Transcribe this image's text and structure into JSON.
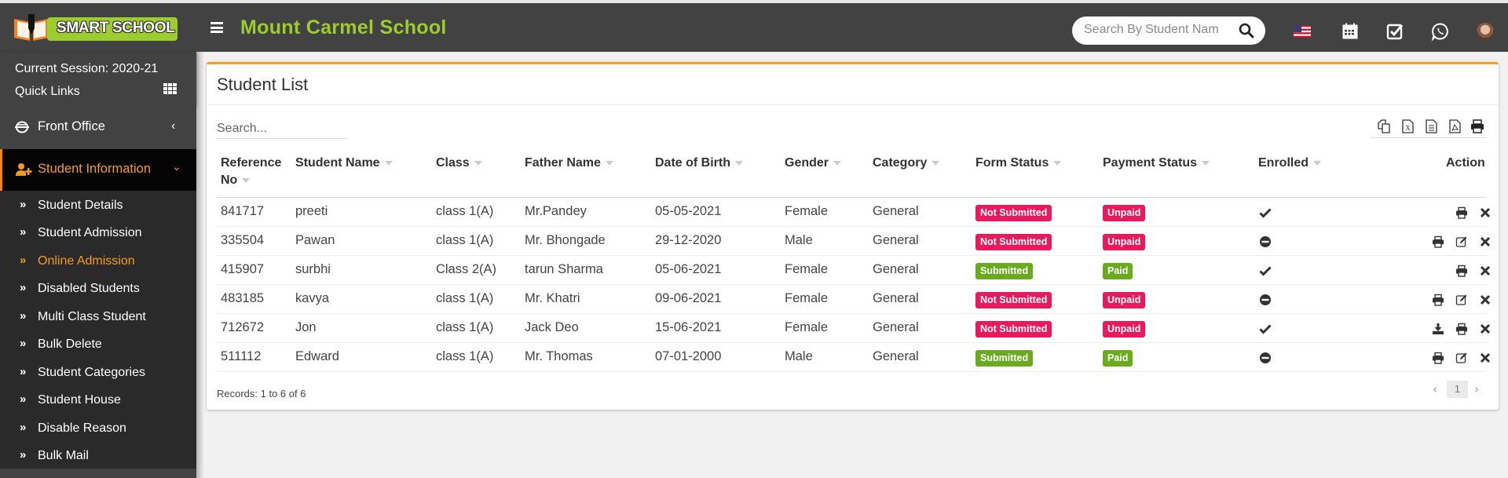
{
  "header": {
    "logo_text": "SMART SCHOOL",
    "school_name": "Mount Carmel School",
    "search_placeholder": "Search By Student Name",
    "icons": [
      "us-flag-icon",
      "calendar-icon",
      "task-check-icon",
      "whatsapp-icon",
      "user-avatar"
    ]
  },
  "sidebar": {
    "session": "Current Session: 2020-21",
    "quick_links": "Quick Links",
    "front_office": "Front Office",
    "student_information": "Student Information",
    "sub_items": [
      {
        "label": "Student Details",
        "active": false
      },
      {
        "label": "Student Admission",
        "active": false
      },
      {
        "label": "Online Admission",
        "active": true
      },
      {
        "label": "Disabled Students",
        "active": false
      },
      {
        "label": "Multi Class Student",
        "active": false
      },
      {
        "label": "Bulk Delete",
        "active": false
      },
      {
        "label": "Student Categories",
        "active": false
      },
      {
        "label": "Student House",
        "active": false
      },
      {
        "label": "Disable Reason",
        "active": false
      },
      {
        "label": "Bulk Mail",
        "active": false
      }
    ]
  },
  "main": {
    "title": "Student List",
    "search_placeholder": "Search...",
    "export_buttons": [
      "copy",
      "excel",
      "csv",
      "pdf",
      "print"
    ],
    "columns": {
      "ref_line1": "Reference",
      "ref_line2": "No",
      "student_name": "Student Name",
      "class": "Class",
      "father_name": "Father Name",
      "dob": "Date of Birth",
      "gender": "Gender",
      "category": "Category",
      "form_status": "Form Status",
      "payment_status": "Payment Status",
      "enrolled": "Enrolled",
      "action": "Action"
    },
    "rows": [
      {
        "ref": "841717",
        "name": "preeti",
        "class": "class 1(A)",
        "father": "Mr.Pandey",
        "dob": "05-05-2021",
        "gender": "Female",
        "category": "General",
        "form_status": "Not Submitted",
        "payment_status": "Unpaid",
        "enrolled": "yes",
        "actions": [
          "print",
          "delete"
        ]
      },
      {
        "ref": "335504",
        "name": "Pawan",
        "class": "class 1(A)",
        "father": "Mr. Bhongade",
        "dob": "29-12-2020",
        "gender": "Male",
        "category": "General",
        "form_status": "Not Submitted",
        "payment_status": "Unpaid",
        "enrolled": "no",
        "actions": [
          "print",
          "edit",
          "delete"
        ]
      },
      {
        "ref": "415907",
        "name": "surbhi",
        "class": "Class 2(A)",
        "father": "tarun Sharma",
        "dob": "05-06-2021",
        "gender": "Female",
        "category": "General",
        "form_status": "Submitted",
        "payment_status": "Paid",
        "enrolled": "yes",
        "actions": [
          "print",
          "delete"
        ]
      },
      {
        "ref": "483185",
        "name": "kavya",
        "class": "class 1(A)",
        "father": "Mr. Khatri",
        "dob": "09-06-2021",
        "gender": "Female",
        "category": "General",
        "form_status": "Not Submitted",
        "payment_status": "Unpaid",
        "enrolled": "no",
        "actions": [
          "print",
          "edit",
          "delete"
        ]
      },
      {
        "ref": "712672",
        "name": "Jon",
        "class": "class 1(A)",
        "father": "Jack Deo",
        "dob": "15-06-2021",
        "gender": "Female",
        "category": "General",
        "form_status": "Not Submitted",
        "payment_status": "Unpaid",
        "enrolled": "yes",
        "actions": [
          "download",
          "print",
          "delete"
        ]
      },
      {
        "ref": "511112",
        "name": "Edward",
        "class": "class 1(A)",
        "father": "Mr. Thomas",
        "dob": "07-01-2000",
        "gender": "Male",
        "category": "General",
        "form_status": "Submitted",
        "payment_status": "Paid",
        "enrolled": "no",
        "actions": [
          "print",
          "edit",
          "delete"
        ]
      }
    ],
    "records_text": "Records: 1 to 6 of 6",
    "pagination": {
      "prev": "‹",
      "current": "1",
      "next": "›"
    }
  },
  "colors": {
    "header_bg": "#424242",
    "brand_green": "#9ccc2e",
    "accent_orange": "#f59a23",
    "card_top": "#f9a01b",
    "badge_red": "#e8195c",
    "badge_green": "#6aaa1e"
  }
}
